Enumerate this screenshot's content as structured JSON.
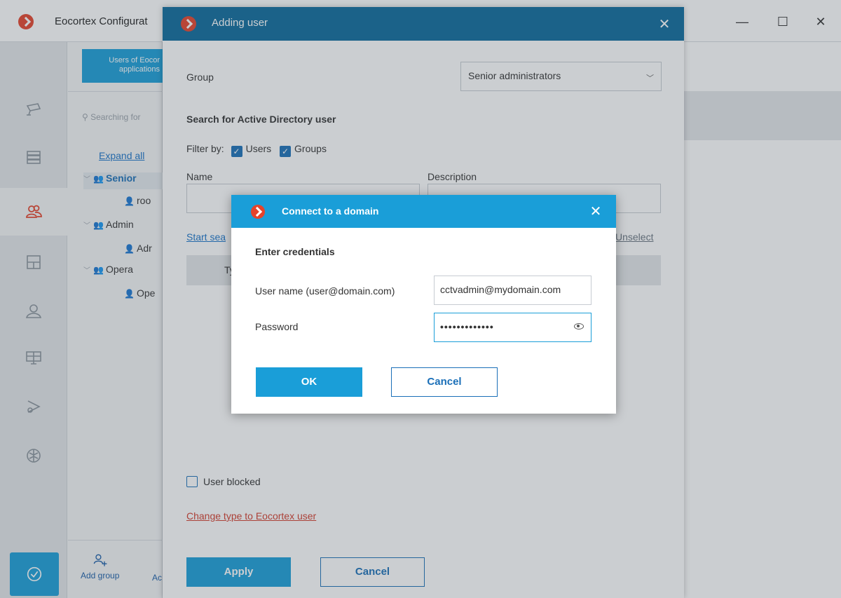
{
  "app": {
    "title": "Eocortex Configurat",
    "window_buttons": {
      "minimize": "—",
      "maximize": "☐",
      "close": "✕"
    }
  },
  "sidebar": {
    "icons": [
      "cameras-icon",
      "servers-icon",
      "users-icon",
      "layouts-icon",
      "persons-icon",
      "monitors-icon",
      "ptz-icon",
      "neural-icon"
    ],
    "active": "users-icon",
    "bottom": "apply-check-icon"
  },
  "panel": {
    "tab_line1": "Users of Eocor",
    "tab_line2": "applications",
    "search_placeholder": "Searching for",
    "expand_all": "Expand all",
    "tree": [
      {
        "label": "Senior",
        "level": 0,
        "type": "group",
        "chevron": "v"
      },
      {
        "label": "roo",
        "level": 1,
        "type": "user"
      },
      {
        "label": "Admin",
        "level": 0,
        "type": "group",
        "chevron": "v"
      },
      {
        "label": "Adr",
        "level": 1,
        "type": "user"
      },
      {
        "label": "Opera",
        "level": 0,
        "type": "group",
        "chevron": "v"
      },
      {
        "label": "Ope",
        "level": 1,
        "type": "user"
      }
    ],
    "add_group": "Add group",
    "add_user": "Ac"
  },
  "dialog": {
    "title": "Adding user",
    "close": "✕",
    "group_label": "Group",
    "group_value": "Senior administrators",
    "search_heading": "Search for Active Directory user",
    "filter_by": "Filter by:",
    "filter_users": "Users",
    "filter_groups": "Groups",
    "name_label": "Name",
    "description_label": "Description",
    "start_search": "Start sea",
    "unselect": "Unselect",
    "table_col_type": "Ty",
    "user_blocked": "User blocked",
    "change_type": "Change type to Eocortex user",
    "apply": "Apply",
    "cancel": "Cancel"
  },
  "connect": {
    "title": "Connect to a domain",
    "close": "✕",
    "heading": "Enter credentials",
    "username_label": "User name (user@domain.com)",
    "username_value": "cctvadmin@mydomain.com",
    "password_label": "Password",
    "password_value": "•••••••••••••",
    "ok": "OK",
    "cancel": "Cancel"
  }
}
